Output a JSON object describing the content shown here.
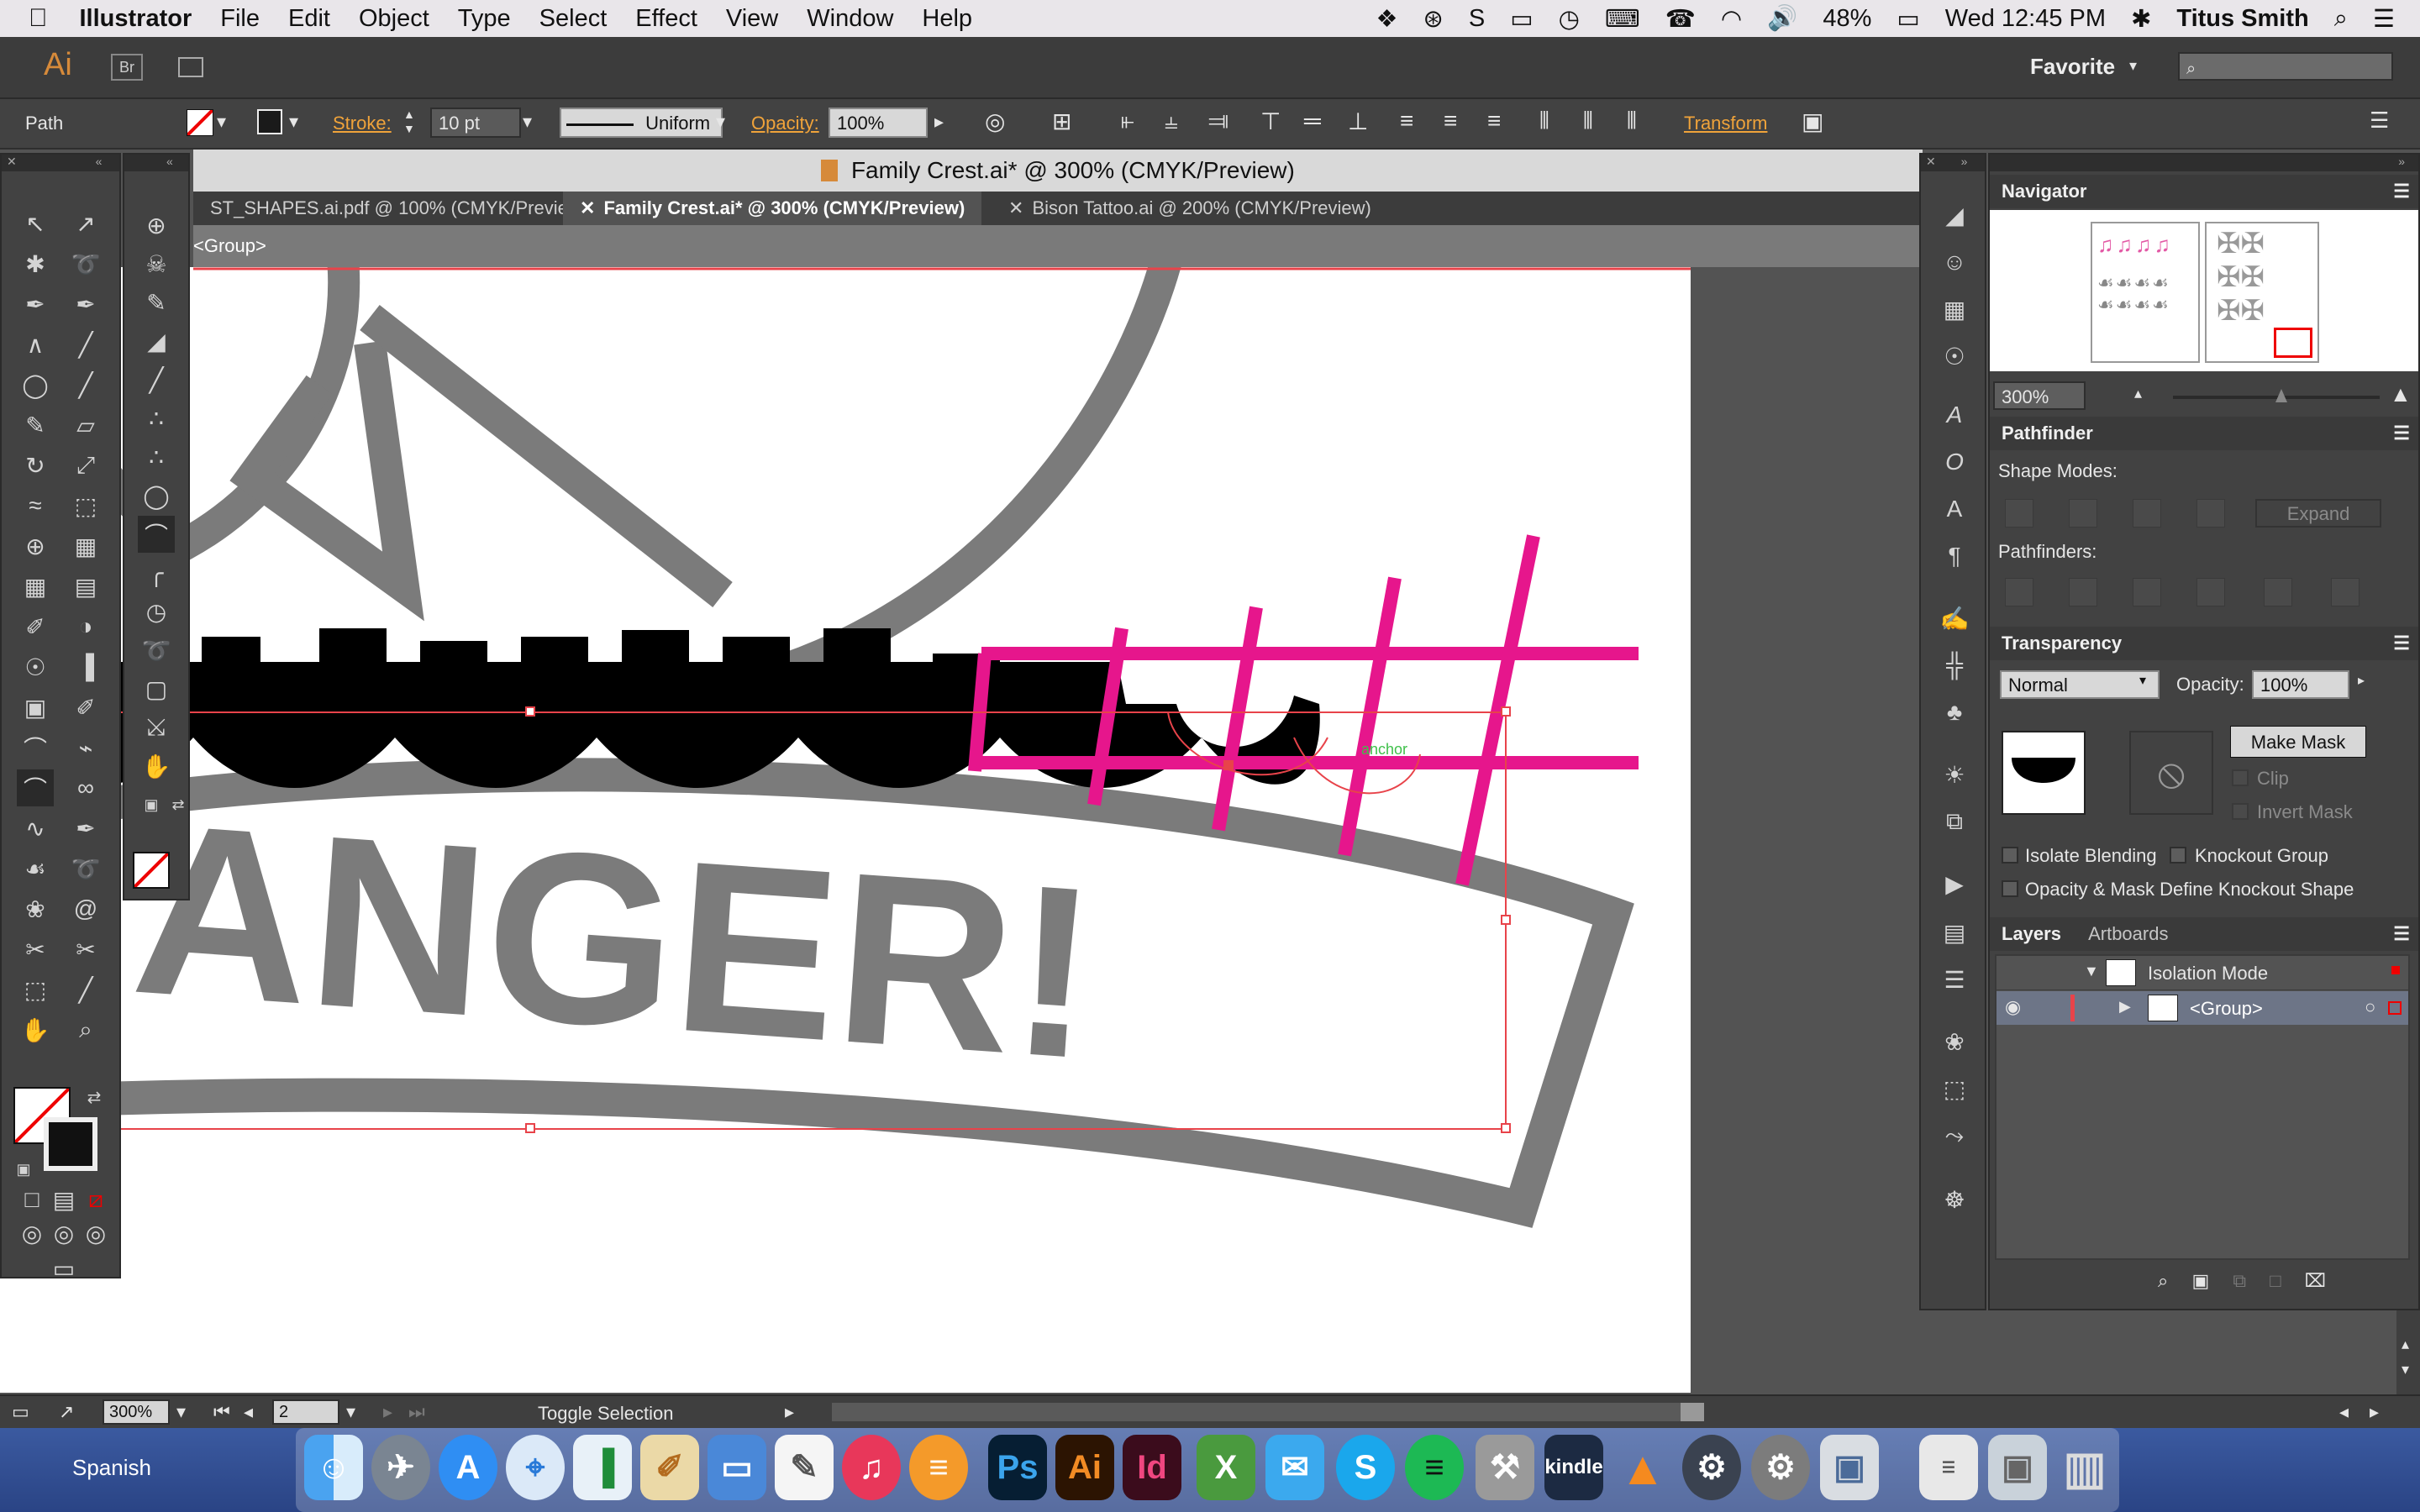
{
  "menubar": {
    "apple_glyph": "",
    "app": "Illustrator",
    "items": [
      "File",
      "Edit",
      "Object",
      "Type",
      "Select",
      "Effect",
      "View",
      "Window",
      "Help"
    ],
    "battery": "48%",
    "clock": "Wed 12:45 PM",
    "user": "Titus Smith"
  },
  "appbar": {
    "ai_logo": "Ai",
    "br_logo": "Br",
    "workspace": "Favorite",
    "search_placeholder": ""
  },
  "control": {
    "selection_type": "Path",
    "stroke_label": "Stroke:",
    "stroke_value": "10 pt",
    "profile": "Uniform",
    "opacity_label": "Opacity:",
    "opacity_value": "100%",
    "transform_label": "Transform"
  },
  "document": {
    "title": "Family Crest.ai* @ 300% (CMYK/Preview)",
    "tabs": [
      {
        "label": "ST_SHAPES.ai.pdf @ 100% (CMYK/Preview)",
        "active": false
      },
      {
        "label": "Family Crest.ai* @ 300% (CMYK/Preview)",
        "active": true
      },
      {
        "label": "Bison Tattoo.ai @ 200% (CMYK/Preview)",
        "active": false
      }
    ],
    "breadcrumb": "<Group>"
  },
  "artwork": {
    "word": "ANGER!",
    "smart_guide_label": "anchor"
  },
  "navigator": {
    "title": "Navigator",
    "zoom": "300%"
  },
  "pathfinder": {
    "title": "Pathfinder",
    "shape_modes": "Shape Modes:",
    "expand": "Expand",
    "pathfinders": "Pathfinders:"
  },
  "transparency": {
    "title": "Transparency",
    "blend_mode": "Normal",
    "opacity_label": "Opacity:",
    "opacity_value": "100%",
    "make_mask": "Make Mask",
    "clip": "Clip",
    "invert_mask": "Invert Mask",
    "isolate_blending": "Isolate Blending",
    "knockout_group": "Knockout Group",
    "opacity_mask_knockout": "Opacity & Mask Define Knockout Shape"
  },
  "layers": {
    "tab_layers": "Layers",
    "tab_artboards": "Artboards",
    "rows": [
      {
        "name": "Isolation Mode"
      },
      {
        "name": "<Group>"
      }
    ]
  },
  "status": {
    "zoom": "300%",
    "artboard": "2",
    "message": "Toggle Selection"
  },
  "dock": {
    "input_source": "Spanish",
    "apps": [
      "Finder",
      "Launchpad",
      "App Store",
      "Safari",
      "Numbers",
      "Preview",
      "Keynote",
      "TextEdit",
      "iTunes",
      "iBooks",
      "Photoshop",
      "Illustrator",
      "InDesign",
      "Excel",
      "Twitter",
      "Skype",
      "Spotify",
      "Cydia",
      "Kindle",
      "VLC",
      "Steam",
      "System Preferences",
      "Image Capture",
      "Log",
      "Photos",
      "Trash"
    ],
    "labels": {
      "ps": "Ps",
      "ai": "Ai",
      "id": "Id",
      "kindle": "kindle"
    }
  },
  "colors": {
    "accent_orange": "#f0a33a",
    "magenta": "#e6168c",
    "crest_gray": "#7b7b7b",
    "selection_red": "#e8434a"
  }
}
